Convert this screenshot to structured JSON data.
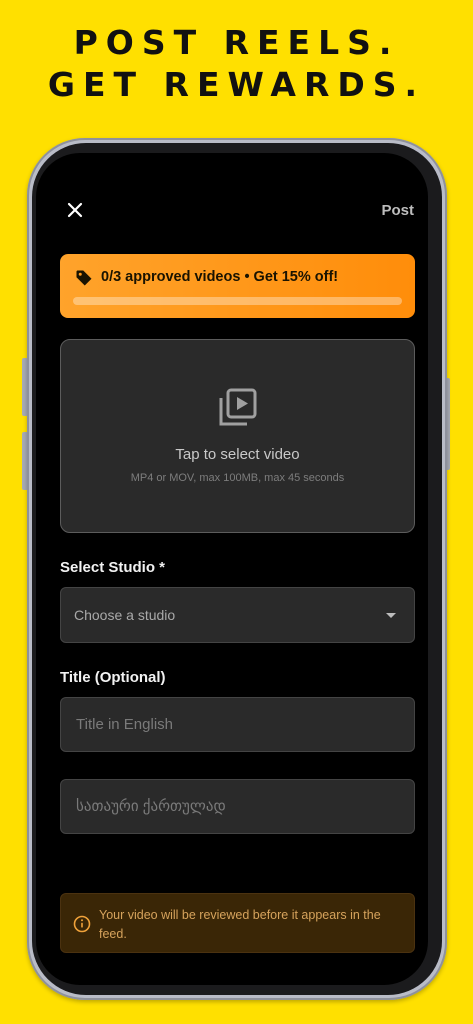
{
  "headline": {
    "line1": "POST REELS.",
    "line2": "GET REWARDS."
  },
  "header": {
    "close_icon": "close-icon",
    "post_label": "Post"
  },
  "promo": {
    "icon": "tag-icon",
    "text": "0/3 approved videos • Get 15% off!",
    "progress": 0
  },
  "video_picker": {
    "icon": "video-library-icon",
    "title": "Tap to select video",
    "hint": "MP4 or MOV, max 100MB, max 45 seconds"
  },
  "studio": {
    "label": "Select Studio *",
    "placeholder": "Choose a studio",
    "caret_icon": "caret-down-icon"
  },
  "title": {
    "label": "Title (Optional)",
    "english_placeholder": "Title in English",
    "georgian_placeholder": "სათაური ქართულად"
  },
  "notice": {
    "icon": "info-icon",
    "text": "Your video will be reviewed before it appears in the feed."
  },
  "colors": {
    "background": "#FFE000",
    "accent": "#FF9A1A",
    "screen": "#000000",
    "field": "#2A2A2A",
    "notice_bg": "#3A2606",
    "notice_text": "#D6A35C"
  }
}
